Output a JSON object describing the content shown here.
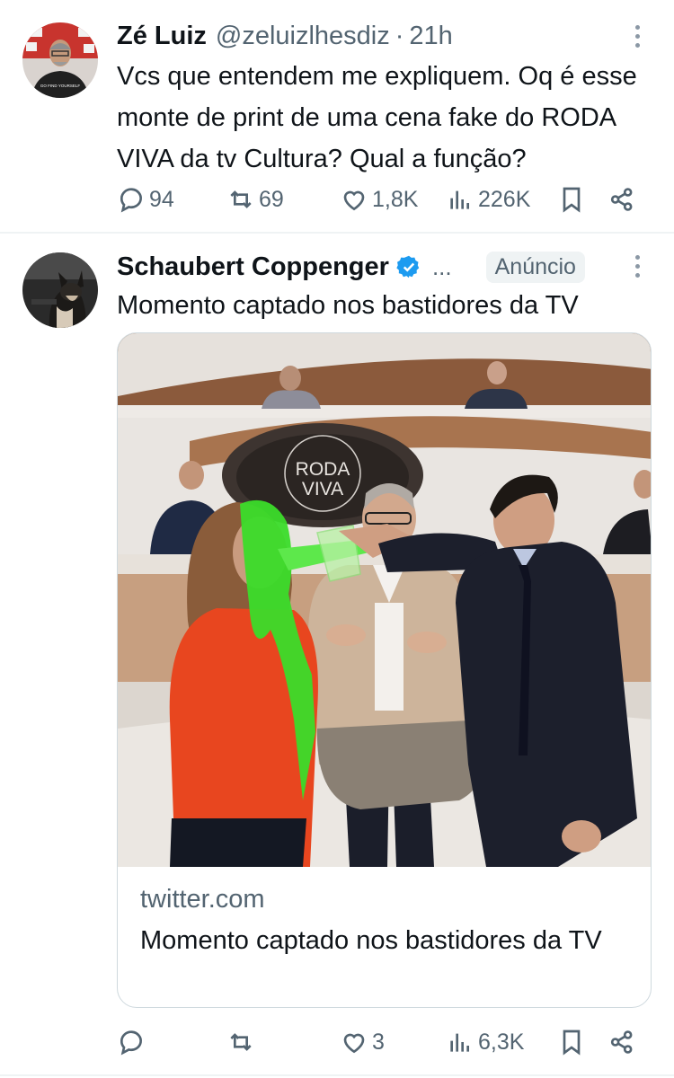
{
  "tweets": [
    {
      "author_name": "Zé Luiz",
      "handle": "@zeluizlhesdiz",
      "dot": "·",
      "time": "21h",
      "text": "Vcs que entendem me expliquem. Oq é esse monte de print de uma cena fake do RODA VIVA da tv Cultura? Qual a função?",
      "avatar_shirt_text": "GO FIND YOURSELF",
      "stats": {
        "replies": "94",
        "retweets": "69",
        "likes": "1,8K",
        "views": "226K"
      }
    },
    {
      "author_name": "Schaubert Coppenger",
      "verified": true,
      "ellipsis": "...",
      "ad_label": "Anúncio",
      "text": "Momento captado nos bastidores da TV",
      "media_logo_line1": "RODA",
      "media_logo_line2": "VIVA",
      "card": {
        "domain": "twitter.com",
        "title": "Momento captado nos bastidores da TV"
      },
      "stats": {
        "replies": "",
        "retweets": "",
        "likes": "3",
        "views": "6,3K"
      }
    }
  ],
  "colors": {
    "text": "#0f1419",
    "secondary": "#536471",
    "verified": "#1d9bf0",
    "slime": "#3bdc2a",
    "coat": "#e8461f"
  },
  "icons": [
    "reply-icon",
    "retweet-icon",
    "like-icon",
    "views-icon",
    "bookmark-icon",
    "share-icon",
    "more-icon",
    "verified-badge-icon"
  ]
}
